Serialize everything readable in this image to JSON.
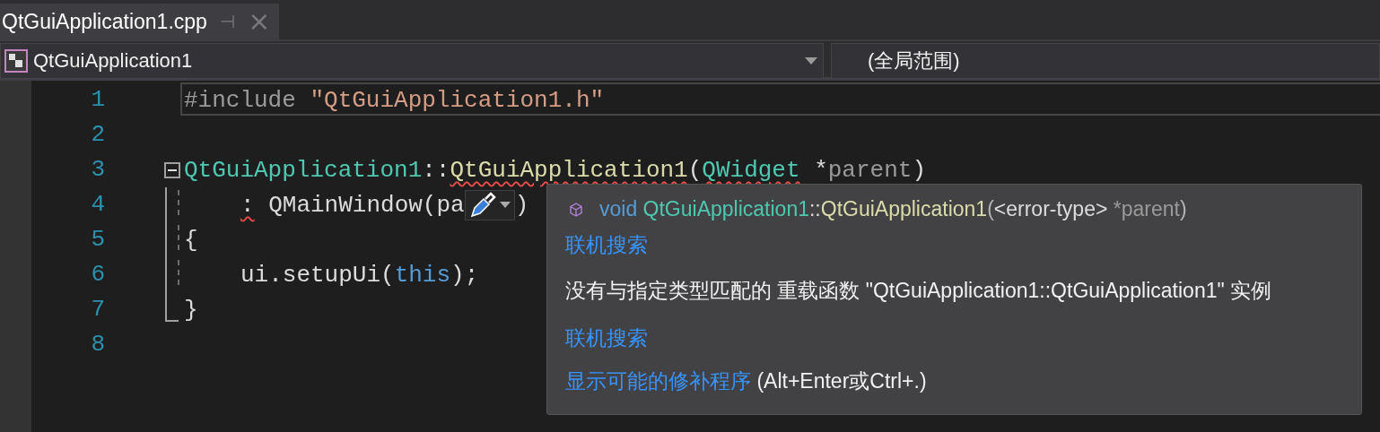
{
  "tab": {
    "title": "QtGuiApplication1.cpp",
    "selected": true,
    "pin": "⊣",
    "close": "×"
  },
  "nav": {
    "scope": "QtGuiApplication1",
    "member": "(全局范围)"
  },
  "lines": [
    {
      "number": "1",
      "current": true,
      "tokens": [
        {
          "kind": "preprocessor",
          "text": "#include "
        },
        {
          "kind": "string",
          "text": "\"QtGuiApplication1.h\""
        }
      ]
    },
    {
      "number": "2",
      "current": false
    },
    {
      "number": "3",
      "current": false,
      "fold": {
        "kind": "start"
      },
      "tokens": [
        {
          "kind": "type",
          "text": "QtGuiApplication1"
        },
        {
          "kind": "plain",
          "text": "::"
        },
        {
          "kind": "function",
          "text": "QtGuiApplication1",
          "error": true
        },
        {
          "kind": "plain",
          "text": "("
        },
        {
          "kind": "type",
          "text": "QWidget",
          "error": true
        },
        {
          "kind": "plain",
          "text": " *"
        },
        {
          "kind": "param",
          "text": "parent"
        },
        {
          "kind": "plain",
          "text": ")"
        }
      ]
    },
    {
      "number": "4",
      "current": false,
      "fold": {
        "kind": "middle"
      },
      "indent": true,
      "tokens": [
        {
          "kind": "plain",
          "text": ":",
          "error": true
        },
        {
          "kind": "plain",
          "text": " QMainWindow(pa"
        },
        {
          "kind": "action"
        },
        {
          "kind": "plain",
          "text": ")"
        }
      ]
    },
    {
      "number": "5",
      "current": false,
      "fold": {
        "kind": "middle"
      },
      "tokens": [
        {
          "kind": "plain",
          "text": "{"
        }
      ]
    },
    {
      "number": "6",
      "current": false,
      "fold": {
        "kind": "middle"
      },
      "indent": true,
      "tokens": [
        {
          "kind": "plain",
          "text": "ui.setupUi("
        },
        {
          "kind": "keyword",
          "text": "this"
        },
        {
          "kind": "plain",
          "text": ");"
        }
      ]
    },
    {
      "number": "7",
      "current": false,
      "fold": {
        "kind": "end"
      },
      "tokens": [
        {
          "kind": "plain",
          "text": "}"
        }
      ]
    },
    {
      "number": "8",
      "current": false
    }
  ],
  "tooltip": {
    "signature": [
      {
        "kind": "keyword",
        "text": "void "
      },
      {
        "kind": "type",
        "text": "QtGuiApplication1"
      },
      {
        "kind": "plain",
        "text": "::"
      },
      {
        "kind": "function",
        "text": "QtGuiApplication1"
      },
      {
        "kind": "punct",
        "text": "("
      },
      {
        "kind": "plain",
        "text": "<error-type>"
      },
      {
        "kind": "param",
        "text": " *parent"
      },
      {
        "kind": "punct",
        "text": ")"
      }
    ],
    "search_link_1": "联机搜索",
    "message": "没有与指定类型匹配的 重载函数 \"QtGuiApplication1::QtGuiApplication1\" 实例",
    "search_link_2": "联机搜索",
    "fix_link": "显示可能的修补程序",
    "fix_shortcut": "(Alt+Enter或Ctrl+.)"
  }
}
